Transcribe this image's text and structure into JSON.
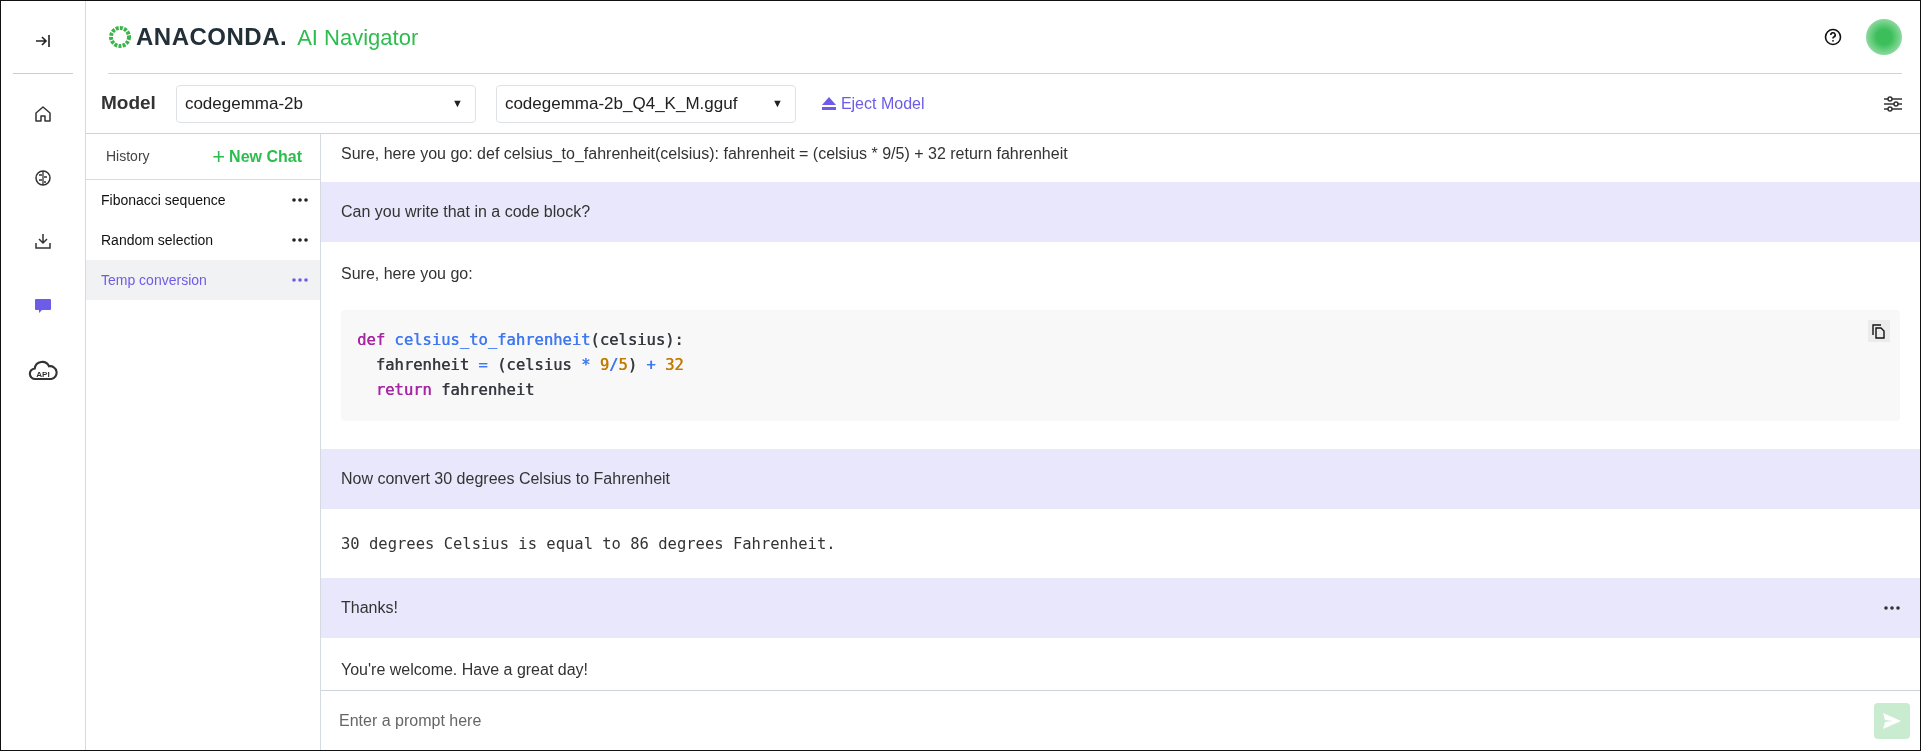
{
  "rail": {
    "items": [
      {
        "kind": "home",
        "selected": false
      },
      {
        "kind": "brain",
        "selected": false
      },
      {
        "kind": "download",
        "selected": false
      },
      {
        "kind": "chat",
        "selected": true
      },
      {
        "kind": "api",
        "label": "API",
        "selected": false
      }
    ]
  },
  "header": {
    "brand": "ANACONDA.",
    "product": "AI Navigator"
  },
  "model_bar": {
    "label": "Model",
    "model": "codegemma-2b",
    "model_caret": "▼",
    "file": "codegemma-2b_Q4_K_M.gguf",
    "file_caret": "▼",
    "eject": "Eject Model"
  },
  "history": {
    "title": "History",
    "new_chat_icon": "+",
    "new_chat": "New Chat",
    "items": [
      {
        "title": "Fibonacci sequence",
        "selected": false
      },
      {
        "title": "Random selection",
        "selected": false
      },
      {
        "title": "Temp conversion",
        "selected": true
      }
    ]
  },
  "messages": [
    {
      "kind": "assistant",
      "text": "Sure, here you go: def celsius_to_fahrenheit(celsius): fahrenheit = (celsius * 9/5) + 32 return fahrenheit"
    },
    {
      "kind": "user",
      "text": "Can you write that in a code block?"
    },
    {
      "kind": "assistant",
      "text": "Sure, here you go:"
    },
    {
      "kind": "code",
      "lines": [
        [
          {
            "text": "def",
            "color": "#a626a4"
          },
          {
            "text": " celsius_to_fahrenheit",
            "color": "#4078f2"
          },
          {
            "text": "(celsius):",
            "color": "#383a42"
          }
        ],
        [
          {
            "text": "  fahrenheit",
            "color": "#383a42"
          },
          {
            "text": " =",
            "color": "#4078f2"
          },
          {
            "text": " (celsius",
            "color": "#383a42"
          },
          {
            "text": " *",
            "color": "#4078f2"
          },
          {
            "text": " 9",
            "color": "#c27b00"
          },
          {
            "text": "/",
            "color": "#4078f2"
          },
          {
            "text": "5",
            "color": "#c27b00"
          },
          {
            "text": ")",
            "color": "#383a42"
          },
          {
            "text": " +",
            "color": "#4078f2"
          },
          {
            "text": " 32",
            "color": "#c27b00"
          }
        ],
        [
          {
            "text": "  return",
            "color": "#a626a4"
          },
          {
            "text": " fahrenheit",
            "color": "#383a42"
          }
        ]
      ]
    },
    {
      "kind": "user",
      "text": "Now convert 30 degrees Celsius to Fahrenheit"
    },
    {
      "kind": "mono",
      "text": "30 degrees Celsius is equal to 86 degrees Fahrenheit."
    },
    {
      "kind": "user",
      "text": "Thanks!",
      "menu": true
    },
    {
      "kind": "assistant",
      "text": "You're welcome. Have a great day!"
    }
  ],
  "prompt": {
    "placeholder": "Enter a prompt here"
  }
}
